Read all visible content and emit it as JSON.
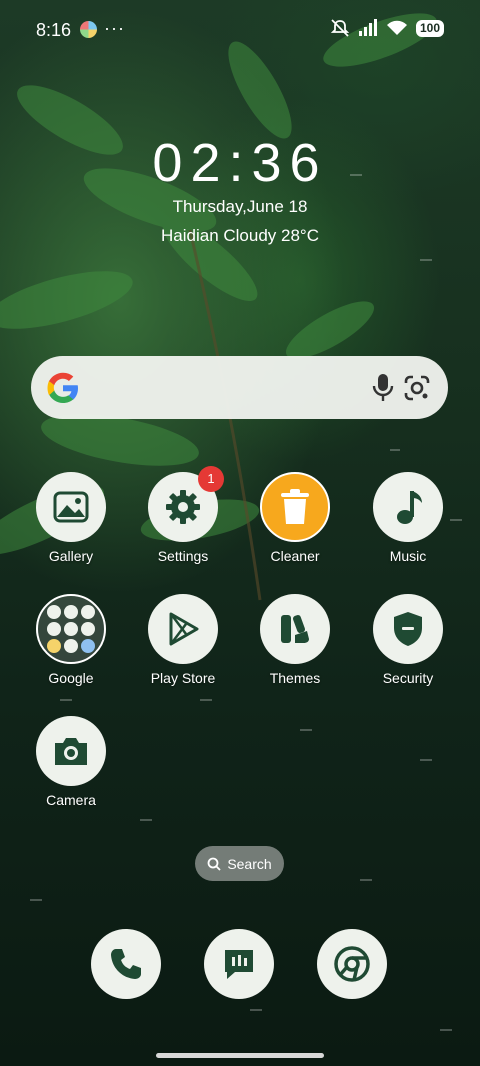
{
  "status_bar": {
    "time": "8:16",
    "more": "···",
    "battery": "100"
  },
  "clock_widget": {
    "time": "02:36",
    "date": "Thursday,June 18",
    "weather": "Haidian Cloudy 28°C"
  },
  "search_bar": {
    "icons": [
      "google-logo-icon",
      "microphone-icon",
      "google-lens-icon"
    ]
  },
  "apps": [
    {
      "label": "Gallery",
      "icon": "gallery-icon"
    },
    {
      "label": "Settings",
      "icon": "gear-icon",
      "badge": "1"
    },
    {
      "label": "Cleaner",
      "icon": "trash-icon"
    },
    {
      "label": "Music",
      "icon": "music-note-icon"
    },
    {
      "label": "Google",
      "icon": "google-folder-icon"
    },
    {
      "label": "Play Store",
      "icon": "play-store-icon"
    },
    {
      "label": "Themes",
      "icon": "themes-icon"
    },
    {
      "label": "Security",
      "icon": "shield-icon"
    },
    {
      "label": "Camera",
      "icon": "camera-icon"
    }
  ],
  "app_search": {
    "label": "Search"
  },
  "dock": [
    {
      "icon": "phone-icon"
    },
    {
      "icon": "messages-icon"
    },
    {
      "icon": "chrome-icon"
    }
  ],
  "colors": {
    "icon_bg": "#eef2ec",
    "icon_fg": "#1f4a33",
    "cleaner": "#f7a81d",
    "badge": "#e53935"
  }
}
